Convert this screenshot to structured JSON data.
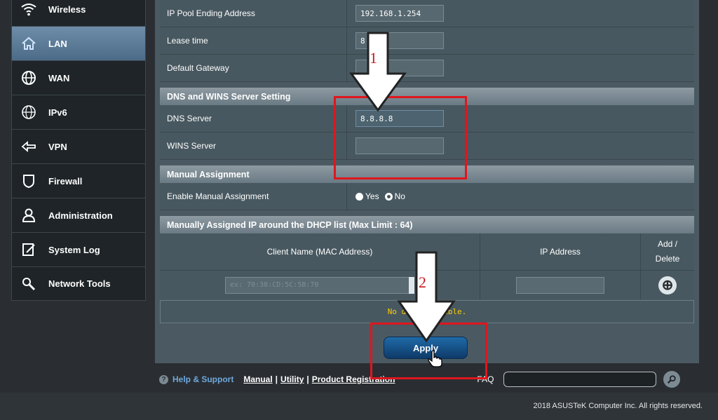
{
  "sidebar": {
    "items": [
      {
        "label": "Wireless",
        "icon": "wifi-icon",
        "active": false
      },
      {
        "label": "LAN",
        "icon": "home-icon",
        "active": true
      },
      {
        "label": "WAN",
        "icon": "globe-icon",
        "active": false
      },
      {
        "label": "IPv6",
        "icon": "ipv6-globe-icon",
        "active": false
      },
      {
        "label": "VPN",
        "icon": "vpn-icon",
        "active": false
      },
      {
        "label": "Firewall",
        "icon": "shield-icon",
        "active": false
      },
      {
        "label": "Administration",
        "icon": "user-icon",
        "active": false
      },
      {
        "label": "System Log",
        "icon": "log-icon",
        "active": false
      },
      {
        "label": "Network Tools",
        "icon": "tools-icon",
        "active": false
      }
    ]
  },
  "dhcp": {
    "pool_end_label": "IP Pool Ending Address",
    "pool_end_value": "192.168.1.254",
    "lease_label": "Lease time",
    "lease_value": "8",
    "gateway_label": "Default Gateway",
    "gateway_value": ""
  },
  "dns_section": {
    "title": "DNS and WINS Server Setting",
    "dns_label": "DNS Server",
    "dns_value": "8.8.8.8",
    "wins_label": "WINS Server",
    "wins_value": ""
  },
  "manual_section": {
    "title": "Manual Assignment",
    "enable_label": "Enable Manual Assignment",
    "yes_label": "Yes",
    "no_label": "No",
    "selected": "No"
  },
  "list_section": {
    "title": "Manually Assigned IP around the DHCP list (Max Limit : 64)",
    "col_client": "Client Name (MAC Address)",
    "col_ip": "IP Address",
    "col_add_delete": "Add / Delete",
    "client_placeholder": "ex: 70:38:CD:5C:5B:70",
    "no_data": "No data in table."
  },
  "apply_label": "Apply",
  "footer": {
    "help": "Help & Support",
    "manual": "Manual",
    "utility": "Utility",
    "product_registration": "Product Registration",
    "faq": "FAQ",
    "copyright": "2018 ASUSTeK Computer Inc. All rights reserved."
  },
  "annotations": {
    "step1": "1",
    "step2": "2",
    "color": "#e0161e"
  }
}
